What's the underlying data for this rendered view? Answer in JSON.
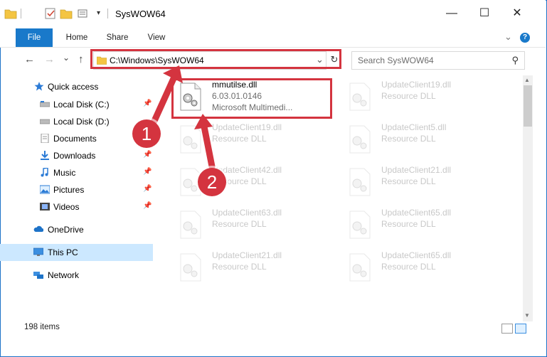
{
  "window": {
    "title": "SysWOW64",
    "minimize": "—",
    "maximize": "☐",
    "close": "✕"
  },
  "ribbon": {
    "tabs": [
      "File",
      "Home",
      "Share",
      "View"
    ],
    "chevron": "⌄",
    "help": "?"
  },
  "nav": {
    "back": "←",
    "forward": "→",
    "recent": "⌄",
    "up": "↑",
    "address": "C:\\Windows\\SysWOW64",
    "dropdown": "⌄",
    "refresh": "↻",
    "search_placeholder": "Search SysWOW64",
    "search_icon": "⚲"
  },
  "sidebar": {
    "items": [
      {
        "label": "Quick access",
        "icon": "star-icon",
        "pinned": false
      },
      {
        "label": "Local Disk (C:)",
        "icon": "drive-icon",
        "pinned": true
      },
      {
        "label": "Local Disk (D:)",
        "icon": "drive-icon",
        "pinned": false
      },
      {
        "label": "Documents",
        "icon": "documents-icon",
        "pinned": false
      },
      {
        "label": "Downloads",
        "icon": "download-icon",
        "pinned": true
      },
      {
        "label": "Music",
        "icon": "music-icon",
        "pinned": true
      },
      {
        "label": "Pictures",
        "icon": "pictures-icon",
        "pinned": true
      },
      {
        "label": "Videos",
        "icon": "videos-icon",
        "pinned": true
      },
      {
        "label": "OneDrive",
        "icon": "cloud-icon",
        "pinned": false
      },
      {
        "label": "This PC",
        "icon": "computer-icon",
        "pinned": false
      },
      {
        "label": "Network",
        "icon": "network-icon",
        "pinned": false
      }
    ],
    "pin_glyph": "📌"
  },
  "files": [
    {
      "name": "mmutilse.dll",
      "line2": "6.03.01.0146",
      "line3": "Microsoft Multimedi...",
      "selected": true
    },
    {
      "name": "UpdateClient19.dll",
      "line2": "Resource DLL"
    },
    {
      "name": "UpdateClient19.dll",
      "line2": "Resource DLL"
    },
    {
      "name": "UpdateClient5.dll",
      "line2": "Resource DLL"
    },
    {
      "name": "UpdateClient42.dll",
      "line2": "Resource DLL"
    },
    {
      "name": "UpdateClient21.dll",
      "line2": "Resource DLL"
    },
    {
      "name": "UpdateClient63.dll",
      "line2": "Resource DLL"
    },
    {
      "name": "UpdateClient65.dll",
      "line2": "Resource DLL"
    },
    {
      "name": "UpdateClient21.dll",
      "line2": "Resource DLL"
    },
    {
      "name": "UpdateClient65.dll",
      "line2": "Resource DLL"
    }
  ],
  "status": {
    "items": "198 items"
  },
  "annotations": {
    "step1": "1",
    "step2": "2",
    "color": "#d4343f"
  }
}
